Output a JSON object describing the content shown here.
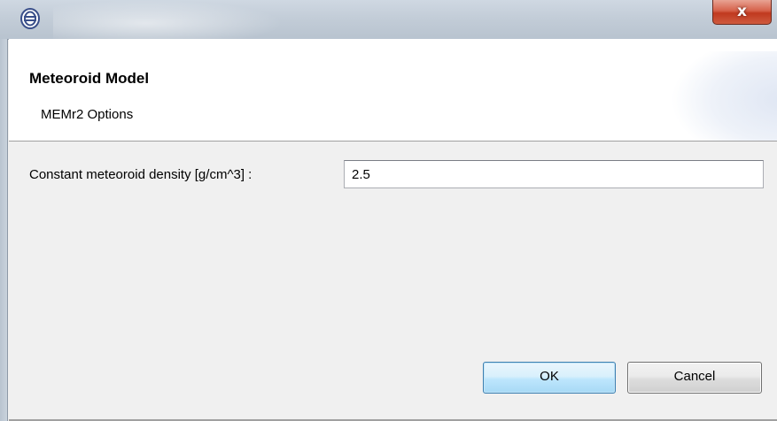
{
  "window": {
    "app_icon": "eclipse-icon",
    "close_label": "x"
  },
  "header": {
    "title": "Meteoroid Model",
    "subtitle": "MEMr2 Options"
  },
  "form": {
    "density_label": "Constant meteoroid density [g/cm^3] :",
    "density_value": "2.5"
  },
  "buttons": {
    "ok_label": "OK",
    "cancel_label": "Cancel"
  }
}
